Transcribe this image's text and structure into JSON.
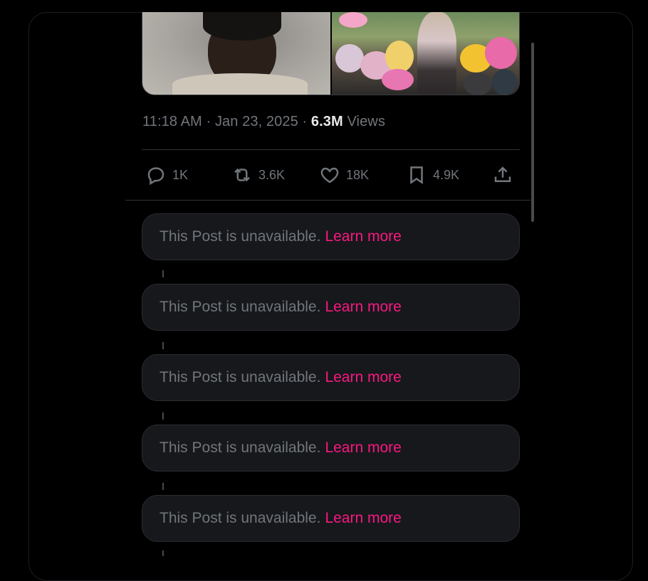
{
  "tweet": {
    "time": "11:18 AM",
    "date": "Jan 23, 2025",
    "views_count": "6.3M",
    "views_label": "Views",
    "separator": "·"
  },
  "media": {
    "items": [
      {
        "name": "mugshot-photo"
      },
      {
        "name": "memorial-flowers-photo"
      }
    ]
  },
  "actions": {
    "reply": {
      "icon": "reply-icon",
      "count": "1K"
    },
    "repost": {
      "icon": "repost-icon",
      "count": "3.6K"
    },
    "like": {
      "icon": "heart-icon",
      "count": "18K"
    },
    "bookmark": {
      "icon": "bookmark-icon",
      "count": "4.9K"
    },
    "share": {
      "icon": "share-icon"
    }
  },
  "unavailable_posts": [
    {
      "message": "This Post is unavailable.",
      "link": "Learn more"
    },
    {
      "message": "This Post is unavailable.",
      "link": "Learn more"
    },
    {
      "message": "This Post is unavailable.",
      "link": "Learn more"
    },
    {
      "message": "This Post is unavailable.",
      "link": "Learn more"
    },
    {
      "message": "This Post is unavailable.",
      "link": "Learn more"
    }
  ],
  "colors": {
    "background": "#000000",
    "muted_text": "#71767b",
    "primary_text": "#e7e9ea",
    "accent_link": "#f91880",
    "card_bg": "#16181c",
    "divider": "#2f3336"
  }
}
